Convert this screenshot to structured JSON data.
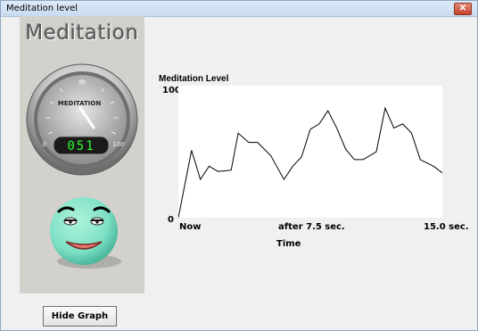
{
  "window": {
    "title": "Meditation level",
    "close_label": "✕"
  },
  "panel": {
    "heading": "Meditation"
  },
  "gauge": {
    "label": "MEDITATION",
    "scale_min": "0",
    "scale_mid": "50",
    "scale_max": "100",
    "readout": "051",
    "value": 51
  },
  "chart_data": {
    "type": "line",
    "title": "Meditation Level",
    "xlabel": "Time",
    "ylabel": "",
    "ytick_labels": [
      "0",
      "100"
    ],
    "xtick_labels": [
      "Now",
      "after 7.5 sec.",
      "15.0 sec."
    ],
    "xlim": [
      0,
      15
    ],
    "ylim": [
      0,
      100
    ],
    "x": [
      0,
      0.75,
      1.25,
      1.75,
      2.25,
      3.0,
      3.4,
      4.0,
      4.5,
      5.25,
      6.0,
      6.5,
      7.0,
      7.5,
      8.0,
      8.5,
      9.0,
      9.5,
      10.0,
      10.5,
      11.25,
      11.75,
      12.25,
      12.75,
      13.25,
      13.75,
      14.5,
      15.0
    ],
    "y": [
      0,
      51,
      29,
      39,
      35,
      36,
      64,
      57,
      57,
      47,
      29,
      39,
      46,
      67,
      71,
      81,
      68,
      52,
      44,
      44,
      50,
      83,
      68,
      71,
      64,
      44,
      39,
      34
    ]
  },
  "buttons": {
    "hide_graph": "Hide Graph"
  },
  "colors": {
    "line": "#000000",
    "readout": "#2dff2d",
    "face": "#7de0c5"
  }
}
